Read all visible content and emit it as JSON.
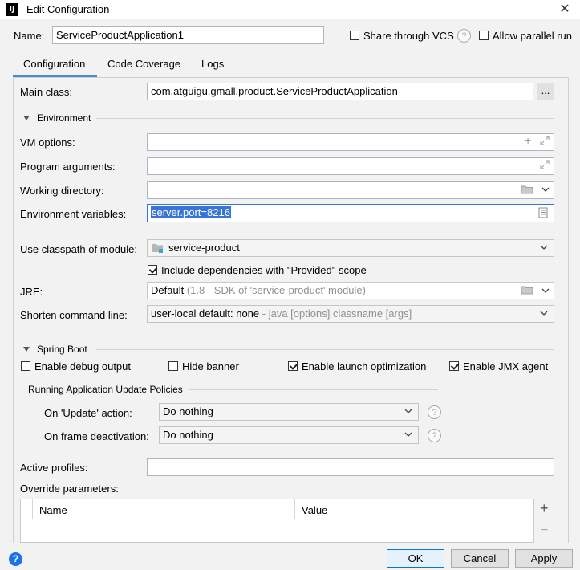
{
  "window": {
    "title": "Edit Configuration",
    "app_icon_text": "IJ"
  },
  "header": {
    "name_label": "Name:",
    "name_value": "ServiceProductApplication1",
    "share_vcs_label": "Share through VCS",
    "share_vcs_checked": false,
    "allow_parallel_label": "Allow parallel run",
    "allow_parallel_checked": false
  },
  "tabs": [
    {
      "label": "Configuration",
      "selected": true
    },
    {
      "label": "Code Coverage",
      "selected": false
    },
    {
      "label": "Logs",
      "selected": false
    }
  ],
  "main": {
    "main_class_label": "Main class:",
    "main_class_value": "com.atguigu.gmall.product.ServiceProductApplication",
    "browse_label": "...",
    "environment_section": "Environment",
    "vm_options_label": "VM options:",
    "vm_options_value": "",
    "program_args_label": "Program arguments:",
    "program_args_value": "",
    "working_dir_label": "Working directory:",
    "working_dir_value": "",
    "env_vars_label": "Environment variables:",
    "env_vars_value": "server.port=8216",
    "classpath_label": "Use classpath of module:",
    "classpath_value": "service-product",
    "include_deps_label": "Include dependencies with \"Provided\" scope",
    "include_deps_checked": true,
    "jre_label": "JRE:",
    "jre_value": "Default",
    "jre_hint": "(1.8 - SDK of 'service-product' module)",
    "shorten_label": "Shorten command line:",
    "shorten_value": "user-local default: none",
    "shorten_hint": "- java [options] classname [args]"
  },
  "spring_boot": {
    "section": "Spring Boot",
    "debug_output_label": "Enable debug output",
    "debug_output_checked": false,
    "hide_banner_label": "Hide banner",
    "hide_banner_checked": false,
    "launch_opt_label": "Enable launch optimization",
    "launch_opt_checked": true,
    "jmx_label": "Enable JMX agent",
    "jmx_checked": true,
    "policies_section": "Running Application Update Policies",
    "update_action_label": "On 'Update' action:",
    "update_action_value": "Do nothing",
    "frame_deactivation_label": "On frame deactivation:",
    "frame_deactivation_value": "Do nothing",
    "help_symbol": "?"
  },
  "profiles": {
    "active_profiles_label": "Active profiles:",
    "active_profiles_value": "",
    "override_params_label": "Override parameters:",
    "columns": [
      "Name",
      "Value"
    ],
    "add_symbol": "+",
    "remove_symbol": "−"
  },
  "footer": {
    "help_symbol": "?",
    "ok_label": "OK",
    "cancel_label": "Cancel",
    "apply_label": "Apply"
  },
  "colors": {
    "accent": "#4a88c7",
    "selection": "#3875d7",
    "help_blue": "#1a73e8"
  }
}
